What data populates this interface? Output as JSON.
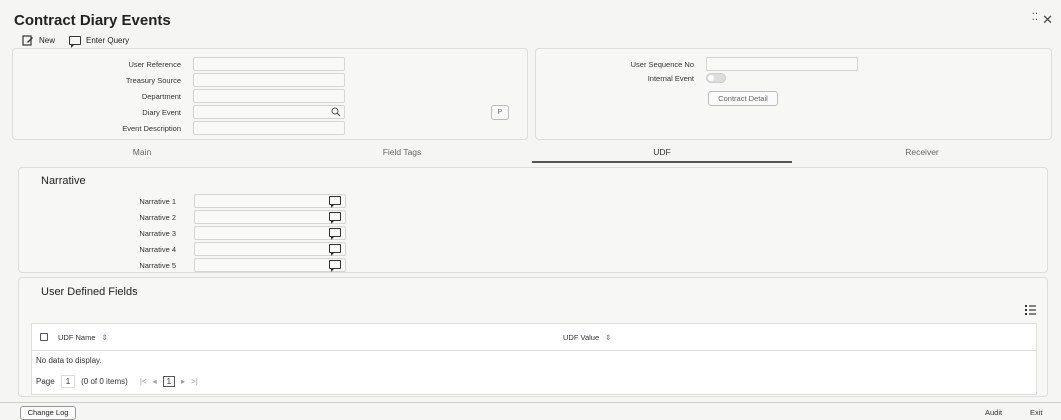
{
  "window": {
    "title": "Contract Diary Events",
    "collapse_symbol": "⁚⁚",
    "close_symbol": "✕"
  },
  "toolbar": {
    "new_label": "New",
    "enter_query_label": "Enter Query"
  },
  "left_form": {
    "fields": [
      {
        "label": "User Reference",
        "value": ""
      },
      {
        "label": "Treasury Source",
        "value": ""
      },
      {
        "label": "Department",
        "value": ""
      },
      {
        "label": "Diary Event",
        "value": ""
      },
      {
        "label": "Event Description",
        "value": ""
      }
    ],
    "p_button": "P"
  },
  "right_form": {
    "user_sequence_label": "User Sequence No",
    "user_sequence_value": "",
    "internal_event_label": "Internal Event",
    "internal_event_on": false,
    "contract_detail_button": "Contract Detail"
  },
  "tabs": [
    {
      "label": "Main",
      "active": false
    },
    {
      "label": "Field Tags",
      "active": false
    },
    {
      "label": "UDF",
      "active": true
    },
    {
      "label": "Receiver",
      "active": false
    }
  ],
  "narrative": {
    "title": "Narrative",
    "fields": [
      {
        "label": "Narrative 1",
        "value": ""
      },
      {
        "label": "Narrative 2",
        "value": ""
      },
      {
        "label": "Narrative 3",
        "value": ""
      },
      {
        "label": "Narrative 4",
        "value": ""
      },
      {
        "label": "Narrative 5",
        "value": ""
      }
    ]
  },
  "udf": {
    "title": "User Defined Fields",
    "columns": [
      "UDF Name",
      "UDF Value"
    ],
    "sort_symbol": "⇕",
    "empty_text": "No data to display.",
    "pagination": {
      "page_label": "Page",
      "page_value": "1",
      "items_text": "(0 of 0 items)",
      "current_page": "1",
      "first_symbol": "|<",
      "prev_symbol": "◂",
      "next_symbol": "▸",
      "last_symbol": ">|"
    }
  },
  "footer": {
    "change_log": "Change Log",
    "audit": "Audit",
    "exit": "Exit"
  },
  "colors": {
    "background": "#f5f5f3",
    "accent": "#555555",
    "border": "#dddddd"
  },
  "icons": [
    "new-icon",
    "enter-query-icon",
    "search-icon",
    "narrative-edit-icon",
    "column-options-icon",
    "close-icon",
    "collapse-icon"
  ]
}
